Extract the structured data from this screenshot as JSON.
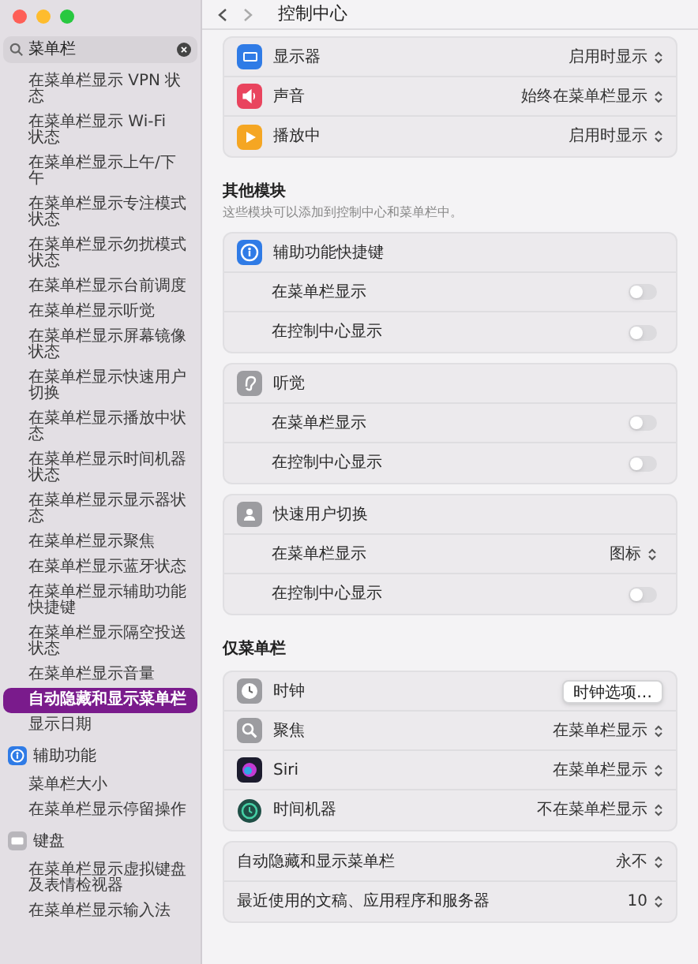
{
  "search": {
    "value": "菜单栏"
  },
  "sidebar": {
    "groups": [
      {
        "items": [
          {
            "label": "在菜单栏显示 VPN 状态",
            "selected": false
          },
          {
            "label": "在菜单栏显示 Wi-Fi 状态",
            "selected": false
          },
          {
            "label": "在菜单栏显示上午/下午",
            "selected": false
          },
          {
            "label": "在菜单栏显示专注模式状态",
            "selected": false
          },
          {
            "label": "在菜单栏显示勿扰模式状态",
            "selected": false
          },
          {
            "label": "在菜单栏显示台前调度",
            "selected": false
          },
          {
            "label": "在菜单栏显示听觉",
            "selected": false
          },
          {
            "label": "在菜单栏显示屏幕镜像状态",
            "selected": false
          },
          {
            "label": "在菜单栏显示快速用户切换",
            "selected": false
          },
          {
            "label": "在菜单栏显示播放中状态",
            "selected": false
          },
          {
            "label": "在菜单栏显示时间机器状态",
            "selected": false
          },
          {
            "label": "在菜单栏显示显示器状态",
            "selected": false
          },
          {
            "label": "在菜单栏显示聚焦",
            "selected": false
          },
          {
            "label": "在菜单栏显示蓝牙状态",
            "selected": false
          },
          {
            "label": "在菜单栏显示辅助功能快捷键",
            "selected": false
          },
          {
            "label": "在菜单栏显示隔空投送状态",
            "selected": false
          },
          {
            "label": "在菜单栏显示音量",
            "selected": false
          },
          {
            "label": "自动隐藏和显示菜单栏",
            "selected": true
          },
          {
            "label": "显示日期",
            "selected": false
          }
        ]
      },
      {
        "title": "辅助功能",
        "kind": "accessibility",
        "items": [
          {
            "label": "菜单栏大小",
            "selected": false
          },
          {
            "label": "在菜单栏显示停留操作",
            "selected": false
          }
        ]
      },
      {
        "title": "键盘",
        "kind": "keyboard",
        "items": [
          {
            "label": "在菜单栏显示虚拟键盘及表情检视器",
            "selected": false
          },
          {
            "label": "在菜单栏显示输入法",
            "selected": false
          }
        ]
      }
    ]
  },
  "content": {
    "title": "控制中心",
    "sections": [
      {
        "cards": [
          {
            "rows": [
              {
                "kind": "popup",
                "label": "显示器",
                "value": "启用时显示"
              },
              {
                "kind": "popup",
                "label": "声音",
                "value": "始终在菜单栏显示"
              },
              {
                "kind": "popup",
                "label": "播放中",
                "value": "启用时显示"
              }
            ]
          }
        ]
      },
      {
        "heading": "其他模块",
        "subtitle": "这些模块可以添加到控制中心和菜单栏中。",
        "cards": [
          {
            "rows": [
              {
                "kind": "title",
                "label": "辅助功能快捷键"
              },
              {
                "kind": "toggle",
                "label": "在菜单栏显示",
                "on": false
              },
              {
                "kind": "toggle",
                "label": "在控制中心显示",
                "on": false
              }
            ]
          },
          {
            "rows": [
              {
                "kind": "title",
                "label": "听觉"
              },
              {
                "kind": "toggle",
                "label": "在菜单栏显示",
                "on": false
              },
              {
                "kind": "toggle",
                "label": "在控制中心显示",
                "on": false
              }
            ]
          },
          {
            "rows": [
              {
                "kind": "title",
                "label": "快速用户切换"
              },
              {
                "kind": "subpopup",
                "label": "在菜单栏显示",
                "value": "图标"
              },
              {
                "kind": "toggle",
                "label": "在控制中心显示",
                "on": false
              }
            ]
          }
        ]
      },
      {
        "heading": "仅菜单栏",
        "cards": [
          {
            "rows": [
              {
                "kind": "button",
                "label": "时钟",
                "value": "时钟选项…"
              },
              {
                "kind": "popup",
                "label": "聚焦",
                "value": "在菜单栏显示"
              },
              {
                "kind": "popup",
                "label": "Siri",
                "value": "在菜单栏显示"
              },
              {
                "kind": "popup",
                "label": "时间机器",
                "value": "不在菜单栏显示"
              }
            ]
          },
          {
            "rows": [
              {
                "kind": "plainpopup",
                "label": "自动隐藏和显示菜单栏",
                "value": "永不"
              },
              {
                "kind": "plainpopup",
                "label": "最近使用的文稿、应用程序和服务器",
                "value": "10"
              }
            ]
          }
        ]
      }
    ]
  }
}
